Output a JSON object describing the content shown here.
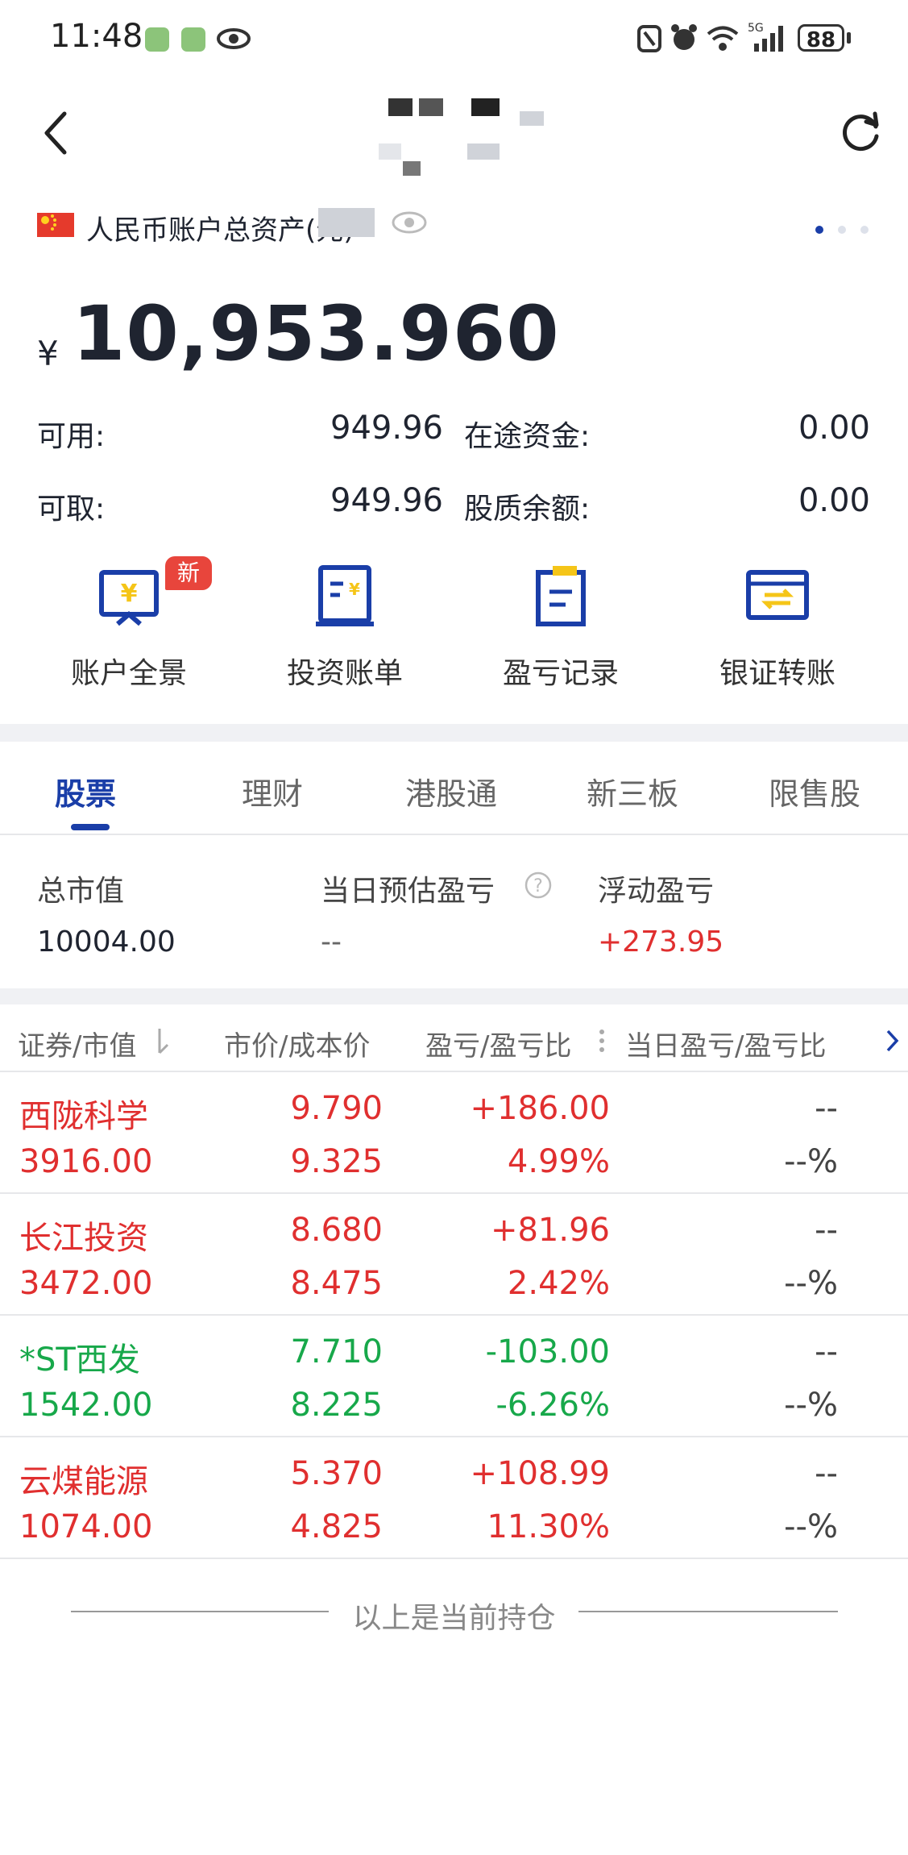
{
  "status_bar": {
    "time": "11:48",
    "battery": "88"
  },
  "account": {
    "title": "人民币账户总资产(元)",
    "currency_symbol": "¥",
    "total": "10,953.960",
    "available_label": "可用:",
    "available_value": "949.96",
    "in_transit_label": "在途资金:",
    "in_transit_value": "0.00",
    "withdrawable_label": "可取:",
    "withdrawable_value": "949.96",
    "pledge_label": "股质余额:",
    "pledge_value": "0.00"
  },
  "actions": [
    {
      "label": "账户全景",
      "icon": "account-overview-icon",
      "badge": "新"
    },
    {
      "label": "投资账单",
      "icon": "investment-bill-icon"
    },
    {
      "label": "盈亏记录",
      "icon": "pnl-record-icon"
    },
    {
      "label": "银证转账",
      "icon": "bank-transfer-icon"
    }
  ],
  "tabs": [
    "股票",
    "理财",
    "港股通",
    "新三板",
    "限售股"
  ],
  "summary": {
    "market_value_label": "总市值",
    "market_value": "10004.00",
    "daily_pnl_label": "当日预估盈亏",
    "daily_pnl": "--",
    "float_pnl_label": "浮动盈亏",
    "float_pnl": "+273.95"
  },
  "table": {
    "headers": [
      "证券/市值",
      "市价/成本价",
      "盈亏/盈亏比",
      "当日盈亏/盈亏比"
    ],
    "rows": [
      {
        "name": "西陇科学",
        "value": "3916.00",
        "price": "9.790",
        "cost": "9.325",
        "pnl": "+186.00",
        "pnl_pct": "4.99%",
        "day_pnl": "--",
        "day_pct": "--%",
        "trend": "up"
      },
      {
        "name": "长江投资",
        "value": "3472.00",
        "price": "8.680",
        "cost": "8.475",
        "pnl": "+81.96",
        "pnl_pct": "2.42%",
        "day_pnl": "--",
        "day_pct": "--%",
        "trend": "up"
      },
      {
        "name": "*ST西发",
        "value": "1542.00",
        "price": "7.710",
        "cost": "8.225",
        "pnl": "-103.00",
        "pnl_pct": "-6.26%",
        "day_pnl": "--",
        "day_pct": "--%",
        "trend": "down"
      },
      {
        "name": "云煤能源",
        "value": "1074.00",
        "price": "5.370",
        "cost": "4.825",
        "pnl": "+108.99",
        "pnl_pct": "11.30%",
        "day_pnl": "--",
        "day_pct": "--%",
        "trend": "up"
      }
    ]
  },
  "footer": "以上是当前持仓",
  "colors": {
    "accent": "#1a3ea8",
    "up": "#e02f2f",
    "down": "#17a84a",
    "icon_yellow": "#f5c518"
  }
}
